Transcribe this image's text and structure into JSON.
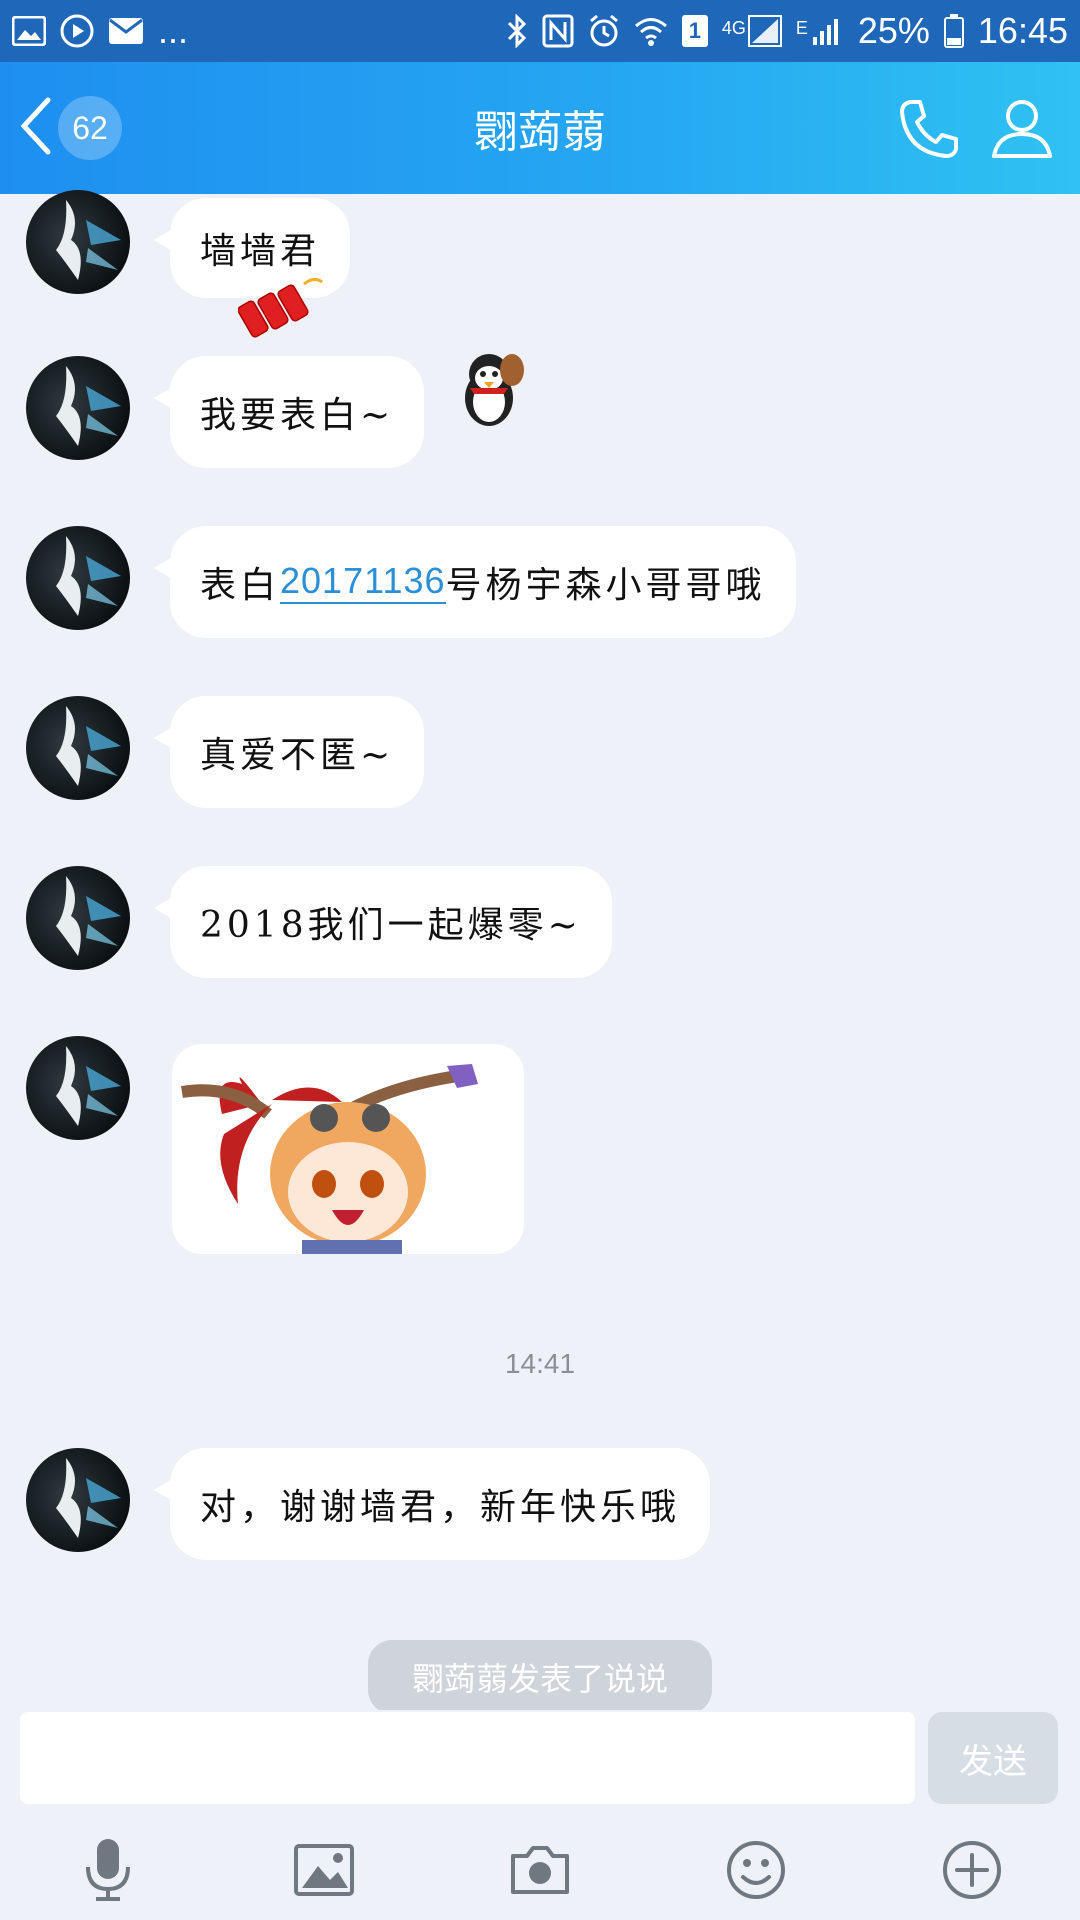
{
  "status_bar": {
    "more": "...",
    "battery_percent": "25%",
    "time": "16:45",
    "network_4g": "4G",
    "network_e": "E",
    "sim": "1"
  },
  "header": {
    "unread_count": "62",
    "title": "翾蒟蒻"
  },
  "messages": [
    {
      "text": "墙墙君"
    },
    {
      "text": "我要表白~"
    },
    {
      "prefix": "表白",
      "link": "20171136",
      "suffix": "号杨宇森小哥哥哦"
    },
    {
      "text": "真爱不匿~"
    },
    {
      "text": "2018我们一起爆零~"
    },
    {
      "sticker": "anime-girl-sticker"
    },
    {
      "text": "对，谢谢墙君，新年快乐哦"
    }
  ],
  "timestamp": "14:41",
  "toast": "翾蒟蒻发表了说说",
  "input": {
    "value": "",
    "send_label": "发送"
  },
  "toolbar": {
    "icons": [
      "microphone-icon",
      "image-icon",
      "camera-icon",
      "emoji-icon",
      "plus-icon"
    ]
  },
  "colors": {
    "status_bar": "#1f67b8",
    "header_start": "#1e8ff0",
    "header_end": "#2fc2f2",
    "link": "#2a8fd6",
    "background": "#eef2f8"
  }
}
